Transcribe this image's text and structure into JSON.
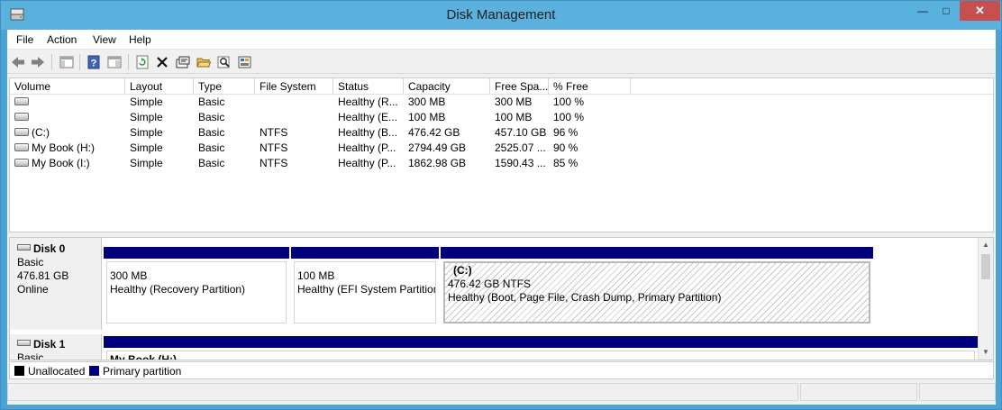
{
  "window": {
    "title": "Disk Management"
  },
  "menu": [
    "File",
    "Action",
    "View",
    "Help"
  ],
  "toolbar": [
    "back-arrow-icon",
    "forward-arrow-icon",
    "console-tree-icon",
    "help-icon",
    "properties-pane-icon",
    "refresh-icon",
    "delete-icon",
    "properties-icon",
    "open-folder-icon",
    "search-icon",
    "settings-icon"
  ],
  "volume_list": {
    "columns": [
      "Volume",
      "Layout",
      "Type",
      "File System",
      "Status",
      "Capacity",
      "Free Spa...",
      "% Free"
    ],
    "rows": [
      {
        "volume": "",
        "layout": "Simple",
        "type": "Basic",
        "fs": "",
        "status": "Healthy (R...",
        "capacity": "300 MB",
        "free": "300 MB",
        "pct": "100 %"
      },
      {
        "volume": "",
        "layout": "Simple",
        "type": "Basic",
        "fs": "",
        "status": "Healthy (E...",
        "capacity": "100 MB",
        "free": "100 MB",
        "pct": "100 %"
      },
      {
        "volume": "(C:)",
        "layout": "Simple",
        "type": "Basic",
        "fs": "NTFS",
        "status": "Healthy (B...",
        "capacity": "476.42 GB",
        "free": "457.10 GB",
        "pct": "96 %"
      },
      {
        "volume": "My Book (H:)",
        "layout": "Simple",
        "type": "Basic",
        "fs": "NTFS",
        "status": "Healthy (P...",
        "capacity": "2794.49 GB",
        "free": "2525.07 ...",
        "pct": "90 %"
      },
      {
        "volume": "My Book (I:)",
        "layout": "Simple",
        "type": "Basic",
        "fs": "NTFS",
        "status": "Healthy (P...",
        "capacity": "1862.98 GB",
        "free": "1590.43 ...",
        "pct": "85 %"
      }
    ]
  },
  "disks": [
    {
      "name": "Disk 0",
      "type": "Basic",
      "size": "476.81 GB",
      "state": "Online",
      "partitions": [
        {
          "title": "",
          "size": "300 MB",
          "status": "Healthy (Recovery Partition)"
        },
        {
          "title": "",
          "size": "100 MB",
          "status": "Healthy (EFI System Partition"
        },
        {
          "title": "(C:)",
          "size": "476.42 GB NTFS",
          "status": "Healthy (Boot, Page File, Crash Dump, Primary Partition)"
        }
      ]
    },
    {
      "name": "Disk 1",
      "type": "Basic",
      "partitions": [
        {
          "title": "My Book  (H:)"
        }
      ]
    }
  ],
  "legend": [
    {
      "label": "Unallocated",
      "color": "#000000"
    },
    {
      "label": "Primary partition",
      "color": "#00007c"
    }
  ],
  "colors": {
    "titlebar": "#5ab1dd",
    "close": "#c74f4f",
    "partition_bar": "#00007c"
  }
}
